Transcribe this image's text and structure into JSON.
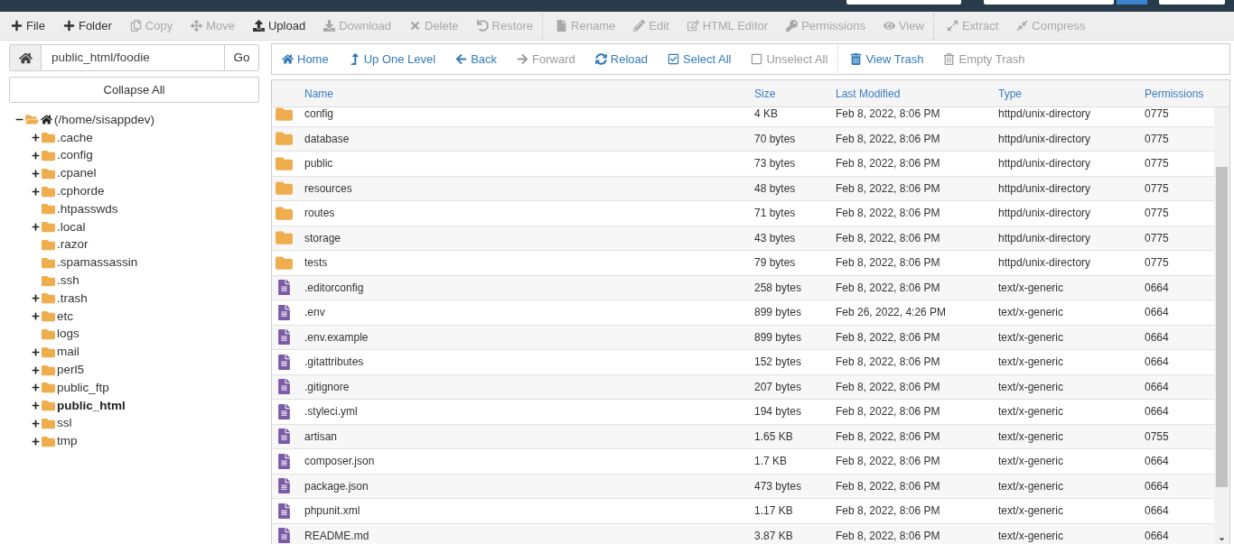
{
  "toolbar": {
    "groups": [
      [
        {
          "label": "File",
          "disabled": false
        },
        {
          "label": "Folder",
          "disabled": false
        },
        {
          "label": "Copy",
          "disabled": true
        },
        {
          "label": "Move",
          "disabled": true
        },
        {
          "label": "Upload",
          "disabled": false
        },
        {
          "label": "Download",
          "disabled": true
        },
        {
          "label": "Delete",
          "disabled": true
        },
        {
          "label": "Restore",
          "disabled": true
        }
      ],
      [
        {
          "label": "Rename",
          "disabled": true
        },
        {
          "label": "Edit",
          "disabled": true
        },
        {
          "label": "HTML Editor",
          "disabled": true
        },
        {
          "label": "Permissions",
          "disabled": true
        },
        {
          "label": "View",
          "disabled": true
        }
      ],
      [
        {
          "label": "Extract",
          "disabled": true
        },
        {
          "label": "Compress",
          "disabled": true
        }
      ]
    ]
  },
  "sidebar": {
    "path_field": {
      "value": "public_html/foodie"
    },
    "go_button": "Go",
    "collapse_button": "Collapse All",
    "tree": [
      {
        "label": "(/home/sisappdev)",
        "expandable": true,
        "expanded": true,
        "selected": false,
        "children": [
          {
            "label": ".cache",
            "expandable": true,
            "expanded": false,
            "selected": false
          },
          {
            "label": ".config",
            "expandable": true,
            "expanded": false,
            "selected": false
          },
          {
            "label": ".cpanel",
            "expandable": true,
            "expanded": false,
            "selected": false
          },
          {
            "label": ".cphorde",
            "expandable": true,
            "expanded": false,
            "selected": false
          },
          {
            "label": ".htpasswds",
            "expandable": false,
            "expanded": false,
            "selected": false
          },
          {
            "label": ".local",
            "expandable": true,
            "expanded": false,
            "selected": false
          },
          {
            "label": ".razor",
            "expandable": false,
            "expanded": false,
            "selected": false
          },
          {
            "label": ".spamassassin",
            "expandable": false,
            "expanded": false,
            "selected": false
          },
          {
            "label": ".ssh",
            "expandable": false,
            "expanded": false,
            "selected": false
          },
          {
            "label": ".trash",
            "expandable": true,
            "expanded": false,
            "selected": false
          },
          {
            "label": "etc",
            "expandable": true,
            "expanded": false,
            "selected": false
          },
          {
            "label": "logs",
            "expandable": false,
            "expanded": false,
            "selected": false
          },
          {
            "label": "mail",
            "expandable": true,
            "expanded": false,
            "selected": false
          },
          {
            "label": "perl5",
            "expandable": true,
            "expanded": false,
            "selected": false
          },
          {
            "label": "public_ftp",
            "expandable": true,
            "expanded": false,
            "selected": false
          },
          {
            "label": "public_html",
            "expandable": true,
            "expanded": false,
            "selected": true
          },
          {
            "label": "ssl",
            "expandable": true,
            "expanded": false,
            "selected": false
          },
          {
            "label": "tmp",
            "expandable": true,
            "expanded": false,
            "selected": false
          }
        ]
      }
    ]
  },
  "file_toolbar": {
    "groups": [
      [
        {
          "label": "Home",
          "disabled": false
        },
        {
          "label": "Up One Level",
          "disabled": false
        },
        {
          "label": "Back",
          "disabled": false
        },
        {
          "label": "Forward",
          "disabled": true
        },
        {
          "label": "Reload",
          "disabled": false
        },
        {
          "label": "Select All",
          "disabled": false
        },
        {
          "label": "Unselect All",
          "disabled": true
        }
      ],
      [
        {
          "label": "View Trash",
          "disabled": false
        },
        {
          "label": "Empty Trash",
          "disabled": true
        }
      ]
    ]
  },
  "table": {
    "columns": [
      "Name",
      "Size",
      "Last Modified",
      "Type",
      "Permissions"
    ],
    "rows": [
      {
        "kind": "folder",
        "name": "config",
        "size": "4 KB",
        "modified": "Feb 8, 2022, 8:06 PM",
        "type": "httpd/unix-directory",
        "permissions": "0775",
        "selected": false
      },
      {
        "kind": "folder",
        "name": "database",
        "size": "70 bytes",
        "modified": "Feb 8, 2022, 8:06 PM",
        "type": "httpd/unix-directory",
        "permissions": "0775",
        "selected": false
      },
      {
        "kind": "folder",
        "name": "public",
        "size": "73 bytes",
        "modified": "Feb 8, 2022, 8:06 PM",
        "type": "httpd/unix-directory",
        "permissions": "0775",
        "selected": false
      },
      {
        "kind": "folder",
        "name": "resources",
        "size": "48 bytes",
        "modified": "Feb 8, 2022, 8:06 PM",
        "type": "httpd/unix-directory",
        "permissions": "0775",
        "selected": false
      },
      {
        "kind": "folder",
        "name": "routes",
        "size": "71 bytes",
        "modified": "Feb 8, 2022, 8:06 PM",
        "type": "httpd/unix-directory",
        "permissions": "0775",
        "selected": false
      },
      {
        "kind": "folder",
        "name": "storage",
        "size": "43 bytes",
        "modified": "Feb 8, 2022, 8:06 PM",
        "type": "httpd/unix-directory",
        "permissions": "0775",
        "selected": false
      },
      {
        "kind": "folder",
        "name": "tests",
        "size": "79 bytes",
        "modified": "Feb 8, 2022, 8:06 PM",
        "type": "httpd/unix-directory",
        "permissions": "0775",
        "selected": false
      },
      {
        "kind": "file",
        "name": ".editorconfig",
        "size": "258 bytes",
        "modified": "Feb 8, 2022, 8:06 PM",
        "type": "text/x-generic",
        "permissions": "0664",
        "selected": false
      },
      {
        "kind": "file",
        "name": ".env",
        "size": "899 bytes",
        "modified": "Feb 26, 2022, 4:26 PM",
        "type": "text/x-generic",
        "permissions": "0664",
        "selected": false
      },
      {
        "kind": "file",
        "name": ".env.example",
        "size": "899 bytes",
        "modified": "Feb 8, 2022, 8:06 PM",
        "type": "text/x-generic",
        "permissions": "0664",
        "selected": false
      },
      {
        "kind": "file",
        "name": ".gitattributes",
        "size": "152 bytes",
        "modified": "Feb 8, 2022, 8:06 PM",
        "type": "text/x-generic",
        "permissions": "0664",
        "selected": false
      },
      {
        "kind": "file",
        "name": ".gitignore",
        "size": "207 bytes",
        "modified": "Feb 8, 2022, 8:06 PM",
        "type": "text/x-generic",
        "permissions": "0664",
        "selected": false
      },
      {
        "kind": "file",
        "name": ".styleci.yml",
        "size": "194 bytes",
        "modified": "Feb 8, 2022, 8:06 PM",
        "type": "text/x-generic",
        "permissions": "0664",
        "selected": false
      },
      {
        "kind": "file",
        "name": "artisan",
        "size": "1.65 KB",
        "modified": "Feb 8, 2022, 8:06 PM",
        "type": "text/x-generic",
        "permissions": "0755",
        "selected": false
      },
      {
        "kind": "file",
        "name": "composer.json",
        "size": "1.7 KB",
        "modified": "Feb 8, 2022, 8:06 PM",
        "type": "text/x-generic",
        "permissions": "0664",
        "selected": false
      },
      {
        "kind": "file",
        "name": "package.json",
        "size": "473 bytes",
        "modified": "Feb 8, 2022, 8:06 PM",
        "type": "text/x-generic",
        "permissions": "0664",
        "selected": false
      },
      {
        "kind": "file",
        "name": "phpunit.xml",
        "size": "1.17 KB",
        "modified": "Feb 8, 2022, 8:06 PM",
        "type": "text/x-generic",
        "permissions": "0664",
        "selected": false
      },
      {
        "kind": "file",
        "name": "README.md",
        "size": "3.87 KB",
        "modified": "Feb 8, 2022, 8:06 PM",
        "type": "text/x-generic",
        "permissions": "0664",
        "selected": false
      }
    ]
  }
}
